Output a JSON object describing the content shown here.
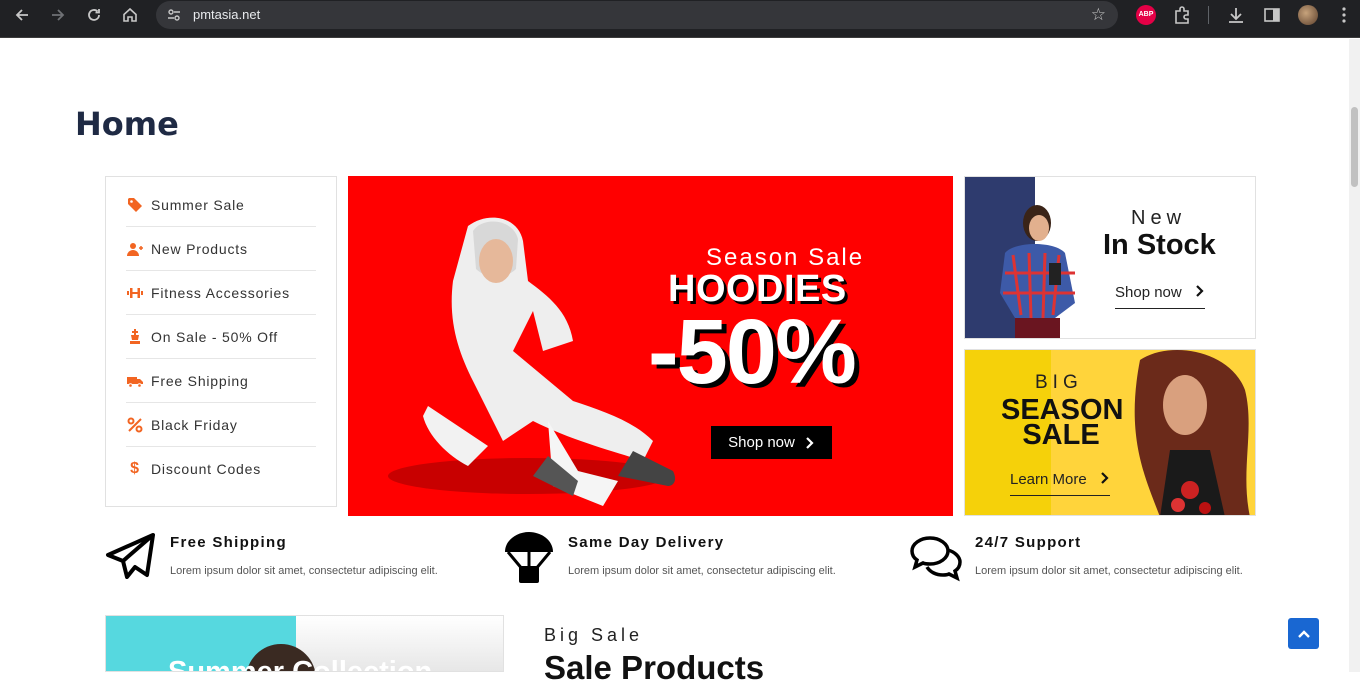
{
  "browser": {
    "url": "pmtasia.net",
    "extension_abp": "ABP"
  },
  "page": {
    "title": "Home"
  },
  "side_menu": {
    "items": [
      {
        "label": "Summer Sale",
        "icon": "tag-icon"
      },
      {
        "label": "New Products",
        "icon": "user-icon"
      },
      {
        "label": "Fitness Accessories",
        "icon": "dumbbell-icon"
      },
      {
        "label": "On Sale - 50% Off",
        "icon": "chess-king-icon"
      },
      {
        "label": "Free Shipping",
        "icon": "truck-icon"
      },
      {
        "label": "Black Friday",
        "icon": "percent-icon"
      },
      {
        "label": "Discount Codes",
        "icon": "dollar-icon"
      }
    ]
  },
  "hero": {
    "eyebrow": "Season Sale",
    "headline": "HOODIES",
    "discount": "-50%",
    "cta": "Shop now"
  },
  "promo_stock": {
    "kicker": "New",
    "title": "In Stock",
    "link": "Shop now"
  },
  "promo_season": {
    "kicker": "BIG",
    "title": "SEASON SALE",
    "link": "Learn More"
  },
  "features": [
    {
      "title": "Free Shipping",
      "text": "Lorem ipsum dolor sit amet, consectetur adipiscing elit.",
      "icon": "paper-plane-icon"
    },
    {
      "title": "Same Day Delivery",
      "text": "Lorem ipsum dolor sit amet, consectetur adipiscing elit.",
      "icon": "parachute-box-icon"
    },
    {
      "title": "24/7 Support",
      "text": "Lorem ipsum dolor sit amet, consectetur adipiscing elit.",
      "icon": "chat-bubbles-icon"
    }
  ],
  "collection": {
    "caption": "Summer Collection"
  },
  "sale_section": {
    "kicker": "Big Sale",
    "title": "Sale Products"
  },
  "colors": {
    "accent": "#f26522",
    "hero_bg": "#ff0000",
    "promo_yellow": "#ffd43b",
    "navy": "#2e3b6e",
    "back_to_top": "#1967d2"
  }
}
